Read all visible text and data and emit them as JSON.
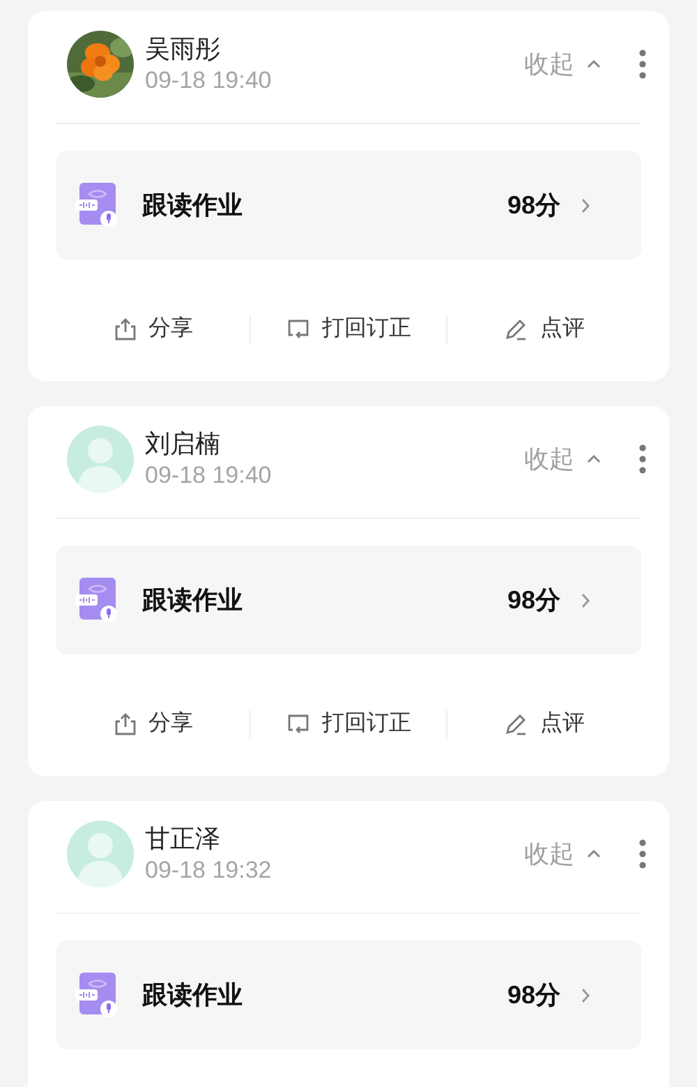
{
  "submissions": [
    {
      "name": "吴雨彤",
      "time": "09-18 19:40",
      "collapse_label": "收起",
      "expanded": true,
      "homework": {
        "title": "跟读作业",
        "score": "98分"
      },
      "actions": [
        {
          "kind": "share",
          "label": "分享"
        },
        {
          "kind": "return",
          "label": "打回订正"
        },
        {
          "kind": "comment",
          "label": "点评"
        }
      ]
    },
    {
      "name": "刘启楠",
      "time": "09-18 19:40",
      "avatar": {
        "kind": "default"
      },
      "collapse_label": "收起",
      "expanded": true,
      "homework": {
        "title": "跟读作业",
        "score": "98分"
      },
      "actions": [
        {
          "kind": "share",
          "label": "分享"
        },
        {
          "kind": "return",
          "label": "打回订正"
        },
        {
          "kind": "comment",
          "label": "点评"
        }
      ]
    },
    {
      "name": "甘正泽",
      "time": "09-18 19:32",
      "avatar": {
        "kind": "default"
      },
      "collapse_label": "收起",
      "expanded": true,
      "homework": {
        "title": "跟读作业",
        "score": "98分"
      }
    }
  ]
}
